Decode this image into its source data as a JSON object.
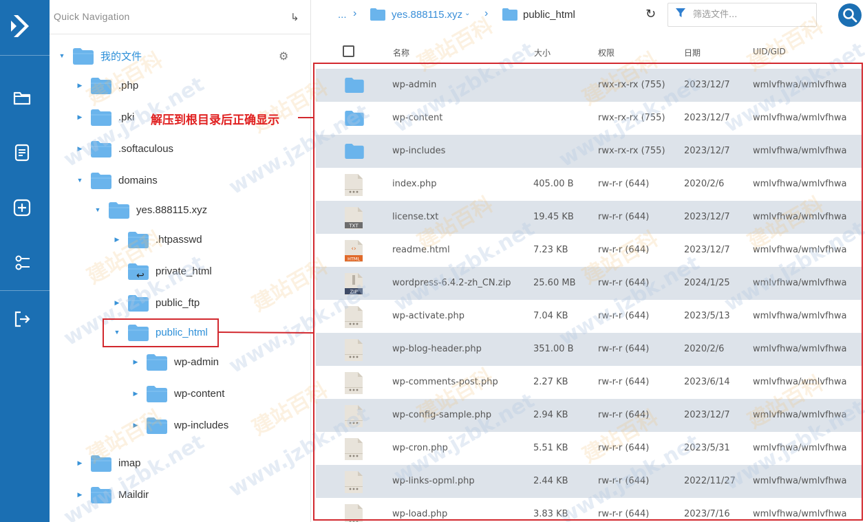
{
  "tree": {
    "header": {
      "title": "Quick Navigation",
      "pin_glyph": "↳"
    },
    "nodes": [
      {
        "label": "我的文件",
        "expanded": true,
        "active": true
      },
      {
        "label": ".php",
        "expanded": false
      },
      {
        "label": ".pki",
        "expanded": false
      },
      {
        "label": ".softaculous",
        "expanded": false
      },
      {
        "label": "domains",
        "expanded": true
      },
      {
        "label": "yes.888115.xyz",
        "expanded": true
      },
      {
        "label": ".htpasswd",
        "expanded": false
      },
      {
        "label": "private_html",
        "symlink": true
      },
      {
        "label": "public_ftp",
        "expanded": false
      },
      {
        "label": "public_html",
        "expanded": true,
        "active": true
      },
      {
        "label": "wp-admin",
        "expanded": false
      },
      {
        "label": "wp-content",
        "expanded": false
      },
      {
        "label": "wp-includes",
        "expanded": false
      },
      {
        "label": "imap",
        "expanded": false
      },
      {
        "label": "Maildir",
        "expanded": false
      }
    ]
  },
  "breadcrumb": {
    "ellipsis": "...",
    "domain": "yes.888115.xyz",
    "current": "public_html"
  },
  "filter": {
    "placeholder": "筛选文件..."
  },
  "table": {
    "headers": {
      "name": "名称",
      "size": "大小",
      "perm": "权限",
      "date": "日期",
      "uid": "UID/GID"
    },
    "rows": [
      {
        "type": "folder",
        "name": "wp-admin",
        "size": "",
        "perm": "rwx-rx-rx (755)",
        "date": "2023/12/7",
        "uid": "wmlvfhwa/wmlvfhwa"
      },
      {
        "type": "folder",
        "name": "wp-content",
        "size": "",
        "perm": "rwx-rx-rx (755)",
        "date": "2023/12/7",
        "uid": "wmlvfhwa/wmlvfhwa"
      },
      {
        "type": "folder",
        "name": "wp-includes",
        "size": "",
        "perm": "rwx-rx-rx (755)",
        "date": "2023/12/7",
        "uid": "wmlvfhwa/wmlvfhwa"
      },
      {
        "type": "file",
        "name": "index.php",
        "size": "405.00 B",
        "perm": "rw-r-r (644)",
        "date": "2020/2/6",
        "uid": "wmlvfhwa/wmlvfhwa"
      },
      {
        "type": "txt",
        "name": "license.txt",
        "size": "19.45 KB",
        "perm": "rw-r-r (644)",
        "date": "2023/12/7",
        "uid": "wmlvfhwa/wmlvfhwa"
      },
      {
        "type": "html",
        "name": "readme.html",
        "size": "7.23 KB",
        "perm": "rw-r-r (644)",
        "date": "2023/12/7",
        "uid": "wmlvfhwa/wmlvfhwa"
      },
      {
        "type": "zip",
        "name": "wordpress-6.4.2-zh_CN.zip",
        "size": "25.60 MB",
        "perm": "rw-r-r (644)",
        "date": "2024/1/25",
        "uid": "wmlvfhwa/wmlvfhwa"
      },
      {
        "type": "file",
        "name": "wp-activate.php",
        "size": "7.04 KB",
        "perm": "rw-r-r (644)",
        "date": "2023/5/13",
        "uid": "wmlvfhwa/wmlvfhwa"
      },
      {
        "type": "file",
        "name": "wp-blog-header.php",
        "size": "351.00 B",
        "perm": "rw-r-r (644)",
        "date": "2020/2/6",
        "uid": "wmlvfhwa/wmlvfhwa"
      },
      {
        "type": "file",
        "name": "wp-comments-post.php",
        "size": "2.27 KB",
        "perm": "rw-r-r (644)",
        "date": "2023/6/14",
        "uid": "wmlvfhwa/wmlvfhwa"
      },
      {
        "type": "file",
        "name": "wp-config-sample.php",
        "size": "2.94 KB",
        "perm": "rw-r-r (644)",
        "date": "2023/12/7",
        "uid": "wmlvfhwa/wmlvfhwa"
      },
      {
        "type": "file",
        "name": "wp-cron.php",
        "size": "5.51 KB",
        "perm": "rw-r-r (644)",
        "date": "2023/5/31",
        "uid": "wmlvfhwa/wmlvfhwa"
      },
      {
        "type": "file",
        "name": "wp-links-opml.php",
        "size": "2.44 KB",
        "perm": "rw-r-r (644)",
        "date": "2022/11/27",
        "uid": "wmlvfhwa/wmlvfhwa"
      },
      {
        "type": "file",
        "name": "wp-load.php",
        "size": "3.83 KB",
        "perm": "rw-r-r (644)",
        "date": "2023/7/16",
        "uid": "wmlvfhwa/wmlvfhwa"
      }
    ]
  },
  "annotation": {
    "text": "解压到根目录后正确显示"
  },
  "watermark": {
    "text": "www.jzbk.net",
    "brand": "建站百科"
  },
  "colors": {
    "rail": "#1b6fb3",
    "folder": "#6ab4ec",
    "accent": "#2d8fd8",
    "row_alt": "#dde3ea",
    "highlight": "#d2282e"
  }
}
